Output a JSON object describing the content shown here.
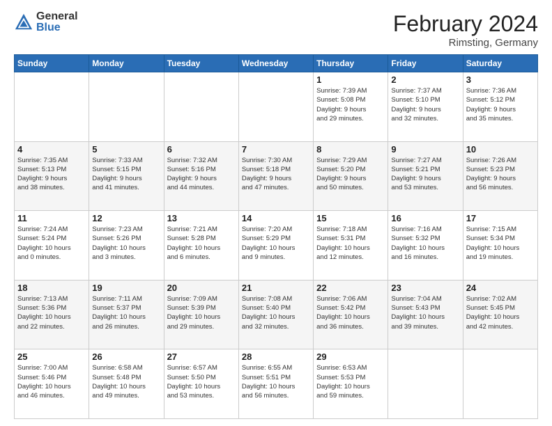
{
  "header": {
    "logo_general": "General",
    "logo_blue": "Blue",
    "month_title": "February 2024",
    "location": "Rimsting, Germany"
  },
  "weekdays": [
    "Sunday",
    "Monday",
    "Tuesday",
    "Wednesday",
    "Thursday",
    "Friday",
    "Saturday"
  ],
  "weeks": [
    [
      {
        "day": "",
        "info": ""
      },
      {
        "day": "",
        "info": ""
      },
      {
        "day": "",
        "info": ""
      },
      {
        "day": "",
        "info": ""
      },
      {
        "day": "1",
        "info": "Sunrise: 7:39 AM\nSunset: 5:08 PM\nDaylight: 9 hours\nand 29 minutes."
      },
      {
        "day": "2",
        "info": "Sunrise: 7:37 AM\nSunset: 5:10 PM\nDaylight: 9 hours\nand 32 minutes."
      },
      {
        "day": "3",
        "info": "Sunrise: 7:36 AM\nSunset: 5:12 PM\nDaylight: 9 hours\nand 35 minutes."
      }
    ],
    [
      {
        "day": "4",
        "info": "Sunrise: 7:35 AM\nSunset: 5:13 PM\nDaylight: 9 hours\nand 38 minutes."
      },
      {
        "day": "5",
        "info": "Sunrise: 7:33 AM\nSunset: 5:15 PM\nDaylight: 9 hours\nand 41 minutes."
      },
      {
        "day": "6",
        "info": "Sunrise: 7:32 AM\nSunset: 5:16 PM\nDaylight: 9 hours\nand 44 minutes."
      },
      {
        "day": "7",
        "info": "Sunrise: 7:30 AM\nSunset: 5:18 PM\nDaylight: 9 hours\nand 47 minutes."
      },
      {
        "day": "8",
        "info": "Sunrise: 7:29 AM\nSunset: 5:20 PM\nDaylight: 9 hours\nand 50 minutes."
      },
      {
        "day": "9",
        "info": "Sunrise: 7:27 AM\nSunset: 5:21 PM\nDaylight: 9 hours\nand 53 minutes."
      },
      {
        "day": "10",
        "info": "Sunrise: 7:26 AM\nSunset: 5:23 PM\nDaylight: 9 hours\nand 56 minutes."
      }
    ],
    [
      {
        "day": "11",
        "info": "Sunrise: 7:24 AM\nSunset: 5:24 PM\nDaylight: 10 hours\nand 0 minutes."
      },
      {
        "day": "12",
        "info": "Sunrise: 7:23 AM\nSunset: 5:26 PM\nDaylight: 10 hours\nand 3 minutes."
      },
      {
        "day": "13",
        "info": "Sunrise: 7:21 AM\nSunset: 5:28 PM\nDaylight: 10 hours\nand 6 minutes."
      },
      {
        "day": "14",
        "info": "Sunrise: 7:20 AM\nSunset: 5:29 PM\nDaylight: 10 hours\nand 9 minutes."
      },
      {
        "day": "15",
        "info": "Sunrise: 7:18 AM\nSunset: 5:31 PM\nDaylight: 10 hours\nand 12 minutes."
      },
      {
        "day": "16",
        "info": "Sunrise: 7:16 AM\nSunset: 5:32 PM\nDaylight: 10 hours\nand 16 minutes."
      },
      {
        "day": "17",
        "info": "Sunrise: 7:15 AM\nSunset: 5:34 PM\nDaylight: 10 hours\nand 19 minutes."
      }
    ],
    [
      {
        "day": "18",
        "info": "Sunrise: 7:13 AM\nSunset: 5:36 PM\nDaylight: 10 hours\nand 22 minutes."
      },
      {
        "day": "19",
        "info": "Sunrise: 7:11 AM\nSunset: 5:37 PM\nDaylight: 10 hours\nand 26 minutes."
      },
      {
        "day": "20",
        "info": "Sunrise: 7:09 AM\nSunset: 5:39 PM\nDaylight: 10 hours\nand 29 minutes."
      },
      {
        "day": "21",
        "info": "Sunrise: 7:08 AM\nSunset: 5:40 PM\nDaylight: 10 hours\nand 32 minutes."
      },
      {
        "day": "22",
        "info": "Sunrise: 7:06 AM\nSunset: 5:42 PM\nDaylight: 10 hours\nand 36 minutes."
      },
      {
        "day": "23",
        "info": "Sunrise: 7:04 AM\nSunset: 5:43 PM\nDaylight: 10 hours\nand 39 minutes."
      },
      {
        "day": "24",
        "info": "Sunrise: 7:02 AM\nSunset: 5:45 PM\nDaylight: 10 hours\nand 42 minutes."
      }
    ],
    [
      {
        "day": "25",
        "info": "Sunrise: 7:00 AM\nSunset: 5:46 PM\nDaylight: 10 hours\nand 46 minutes."
      },
      {
        "day": "26",
        "info": "Sunrise: 6:58 AM\nSunset: 5:48 PM\nDaylight: 10 hours\nand 49 minutes."
      },
      {
        "day": "27",
        "info": "Sunrise: 6:57 AM\nSunset: 5:50 PM\nDaylight: 10 hours\nand 53 minutes."
      },
      {
        "day": "28",
        "info": "Sunrise: 6:55 AM\nSunset: 5:51 PM\nDaylight: 10 hours\nand 56 minutes."
      },
      {
        "day": "29",
        "info": "Sunrise: 6:53 AM\nSunset: 5:53 PM\nDaylight: 10 hours\nand 59 minutes."
      },
      {
        "day": "",
        "info": ""
      },
      {
        "day": "",
        "info": ""
      }
    ]
  ]
}
